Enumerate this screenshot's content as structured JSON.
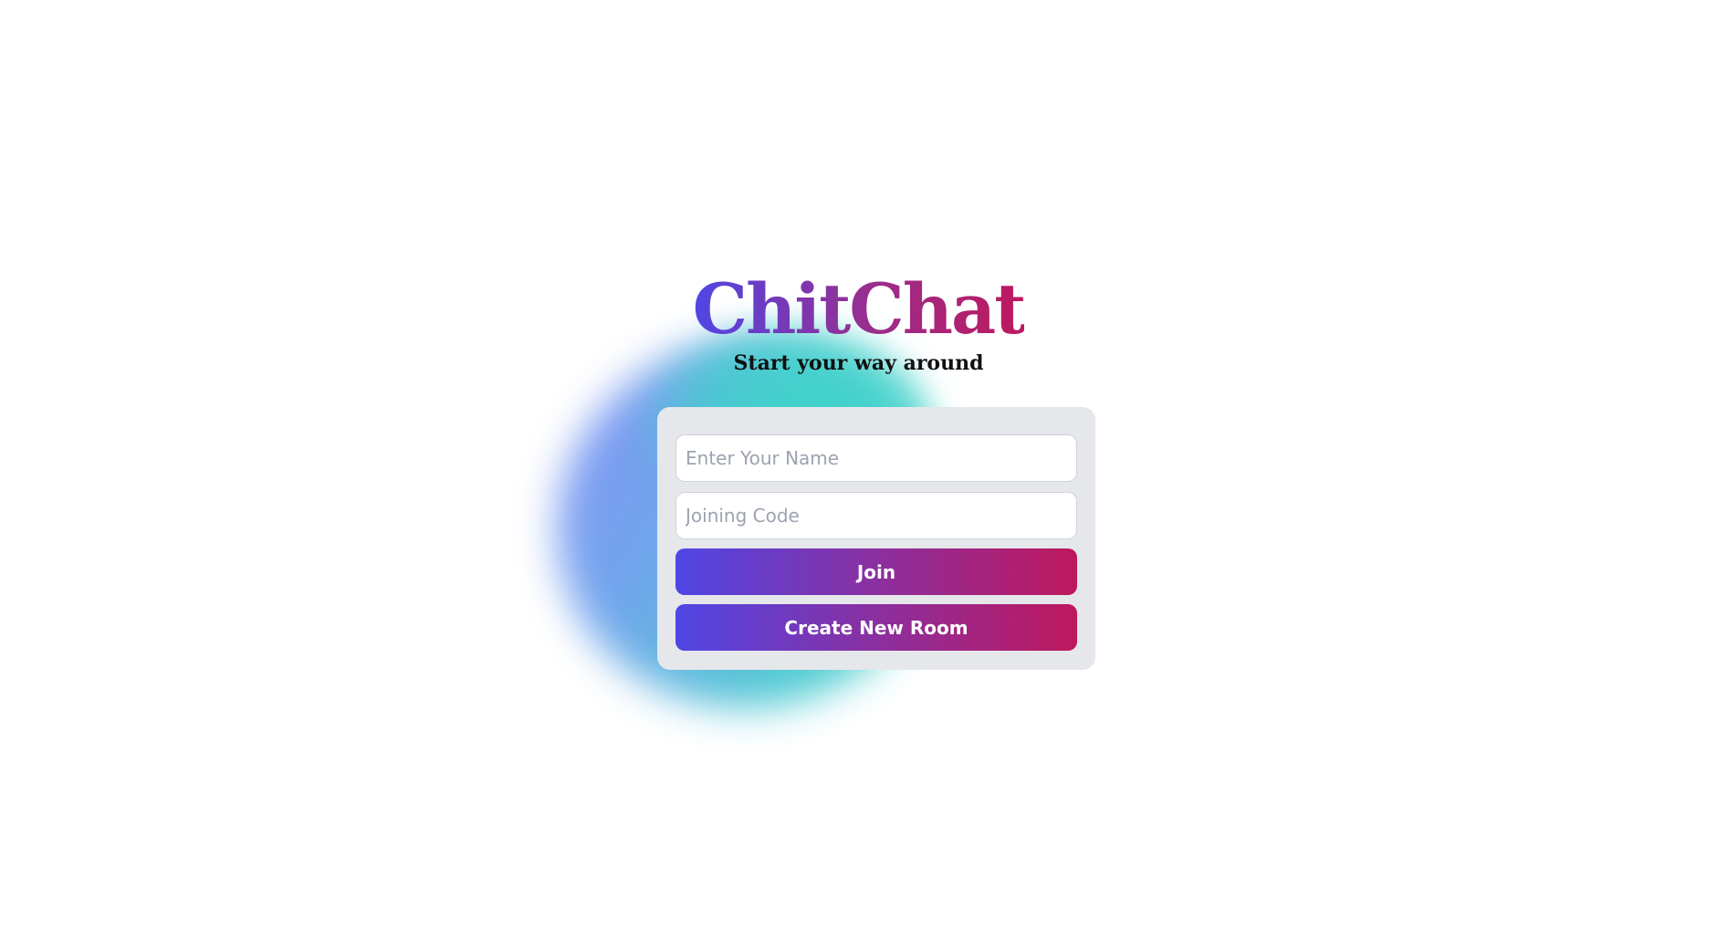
{
  "app": {
    "title": "ChitChat",
    "subtitle": "Start your way around"
  },
  "form": {
    "name_placeholder": "Enter Your Name",
    "name_value": "",
    "code_placeholder": "Joining Code",
    "code_value": "",
    "join_label": "Join",
    "create_label": "Create New Room"
  },
  "colors": {
    "gradient_start": "#4f46e5",
    "gradient_end": "#be185d",
    "card_background": "#e5e7eb",
    "blob_blue": "#7f8cf5",
    "blob_teal": "#3fd0c7"
  }
}
